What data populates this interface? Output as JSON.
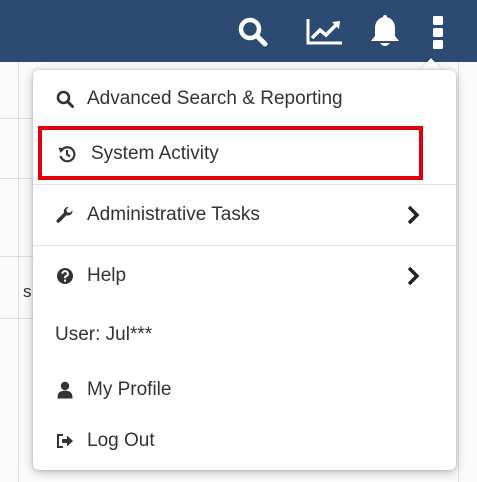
{
  "topbar": {
    "color": "#2c4a72",
    "icons": [
      "search-icon",
      "chart-icon",
      "bell-icon",
      "more-vertical-icon"
    ]
  },
  "background": {
    "fragment": "s"
  },
  "menu": {
    "items": [
      {
        "label": "Advanced Search & Reporting",
        "icon": "search-icon"
      },
      {
        "label": "System Activity",
        "icon": "history-icon"
      },
      {
        "label": "Administrative Tasks",
        "icon": "wrench-icon",
        "has_submenu": true
      },
      {
        "label": "Help",
        "icon": "question-circle-icon",
        "has_submenu": true
      }
    ],
    "user_label": "User: Jul***",
    "account_items": [
      {
        "label": "My Profile",
        "icon": "user-icon"
      },
      {
        "label": "Log Out",
        "icon": "logout-icon"
      }
    ],
    "highlight_color": "#e3000b"
  }
}
